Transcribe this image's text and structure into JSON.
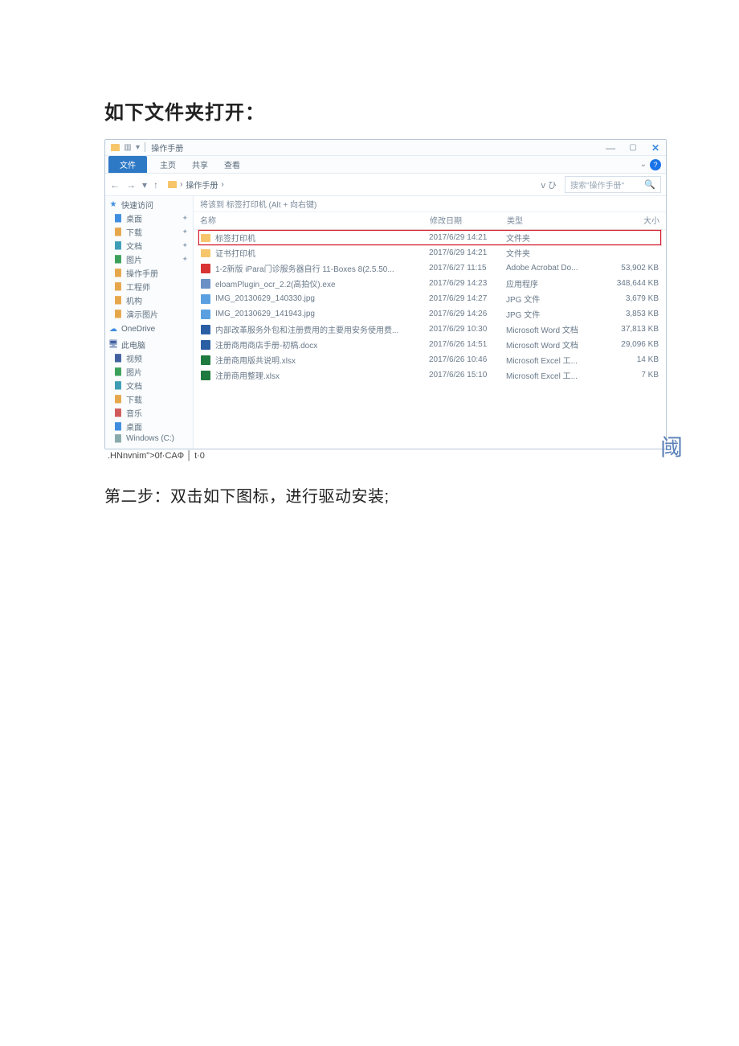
{
  "heading": "如下文件夹打开：",
  "explorer": {
    "titlebar": {
      "title": "操作手册"
    },
    "ribbon": {
      "file": "文件",
      "tabs": [
        "主页",
        "共享",
        "查看"
      ]
    },
    "breadcrumb": {
      "folder": "操作手册",
      "sep": " › ",
      "prefix": "› "
    },
    "refresh_hint": "v ひ",
    "search": {
      "placeholder": "搜索\"操作手册\""
    },
    "dispatch": "将该到 标签打印机 (Alt + 向右键)",
    "columns": {
      "name": "名称",
      "date": "修改日期",
      "type": "类型",
      "size": "大小"
    },
    "files": [
      {
        "icon": "folder",
        "name": "标签打印机",
        "date": "2017/6/29 14:21",
        "type": "文件夹",
        "size": "",
        "selected": true
      },
      {
        "icon": "folder",
        "name": "证书打印机",
        "date": "2017/6/29 14:21",
        "type": "文件夹",
        "size": ""
      },
      {
        "icon": "pdf",
        "name": "1-2新版 iPara门诊服务器自行 11-Boxes 8(2.5.50...",
        "date": "2017/6/27 11:15",
        "type": "Adobe Acrobat Do...",
        "size": "53,902 KB"
      },
      {
        "icon": "exe",
        "name": "eloamPlugin_ocr_2.2(高拍仪).exe",
        "date": "2017/6/29 14:23",
        "type": "应用程序",
        "size": "348,644 KB"
      },
      {
        "icon": "img",
        "name": "IMG_20130629_140330.jpg",
        "date": "2017/6/29 14:27",
        "type": "JPG 文件",
        "size": "3,679 KB"
      },
      {
        "icon": "img",
        "name": "IMG_20130629_141943.jpg",
        "date": "2017/6/29 14:26",
        "type": "JPG 文件",
        "size": "3,853 KB"
      },
      {
        "icon": "word",
        "name": "内部改革服务外包和注册费用的主要用安务使用费...",
        "date": "2017/6/29 10:30",
        "type": "Microsoft Word 文档",
        "size": "37,813 KB"
      },
      {
        "icon": "word",
        "name": "注册商用商店手册-初稿.docx",
        "date": "2017/6/26 14:51",
        "type": "Microsoft Word 文档",
        "size": "29,096 KB"
      },
      {
        "icon": "excel",
        "name": "注册商用版共说明.xlsx",
        "date": "2017/6/26 10:46",
        "type": "Microsoft Excel 工...",
        "size": "14 KB"
      },
      {
        "icon": "excel",
        "name": "注册商用整理.xlsx",
        "date": "2017/6/26 15:10",
        "type": "Microsoft Excel 工...",
        "size": "7 KB"
      }
    ],
    "sidebar": {
      "quick_access": "快速访问",
      "quick_items": [
        {
          "label": "桌面",
          "color": "s-blue",
          "pin": true
        },
        {
          "label": "下载",
          "color": "s-orange",
          "pin": true
        },
        {
          "label": "文档",
          "color": "s-teal",
          "pin": true
        },
        {
          "label": "图片",
          "color": "s-green",
          "pin": true
        },
        {
          "label": "操作手册",
          "color": "s-orange"
        },
        {
          "label": "工程师",
          "color": "s-orange"
        },
        {
          "label": "机构",
          "color": "s-orange"
        },
        {
          "label": "演示图片",
          "color": "s-orange"
        }
      ],
      "onedrive": "OneDrive",
      "this_pc": "此电脑",
      "pc_items": [
        {
          "label": "视频",
          "color": "s-navy"
        },
        {
          "label": "图片",
          "color": "s-green"
        },
        {
          "label": "文档",
          "color": "s-teal"
        },
        {
          "label": "下载",
          "color": "s-orange"
        },
        {
          "label": "音乐",
          "color": "s-red"
        },
        {
          "label": "桌面",
          "color": "s-blue"
        },
        {
          "label": "Windows (C:)",
          "color": "s-gray"
        }
      ]
    }
  },
  "footer": {
    "text": ".HNnvnim\">0f·CAФ │ t·0"
  },
  "step2": "第二步：双击如下图标，进行驱动安装;",
  "glyph_right": "阈"
}
